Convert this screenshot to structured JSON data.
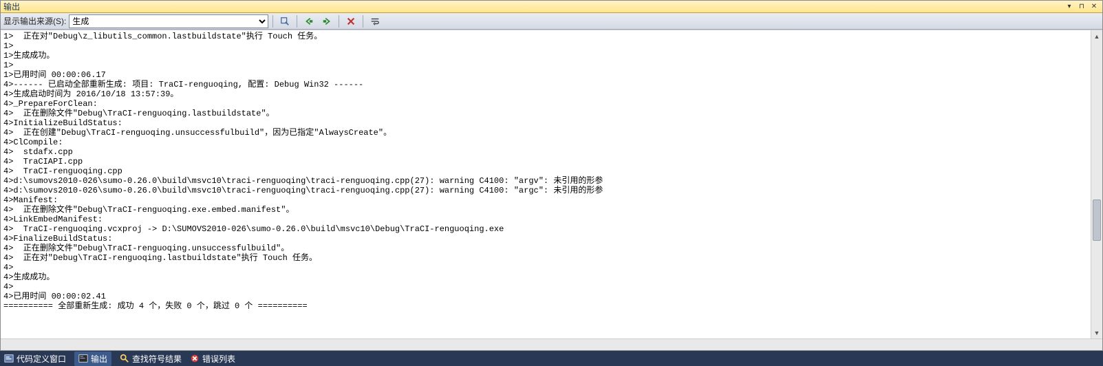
{
  "titlebar": {
    "title": "输出"
  },
  "toolbar": {
    "source_label": "显示输出来源(S):",
    "source_value": "生成"
  },
  "output_lines": [
    "1>  正在对\"Debug\\z_libutils_common.lastbuildstate\"执行 Touch 任务。",
    "1>",
    "1>生成成功。",
    "1>",
    "1>已用时间 00:00:06.17",
    "4>------ 已启动全部重新生成: 项目: TraCI-renguoqing, 配置: Debug Win32 ------",
    "4>生成启动时间为 2016/10/18 13:57:39。",
    "4>_PrepareForClean:",
    "4>  正在删除文件\"Debug\\TraCI-renguoqing.lastbuildstate\"。",
    "4>InitializeBuildStatus:",
    "4>  正在创建\"Debug\\TraCI-renguoqing.unsuccessfulbuild\"，因为已指定\"AlwaysCreate\"。",
    "4>ClCompile:",
    "4>  stdafx.cpp",
    "4>  TraCIAPI.cpp",
    "4>  TraCI-renguoqing.cpp",
    "4>d:\\sumovs2010-026\\sumo-0.26.0\\build\\msvc10\\traci-renguoqing\\traci-renguoqing.cpp(27): warning C4100: \"argv\": 未引用的形参",
    "4>d:\\sumovs2010-026\\sumo-0.26.0\\build\\msvc10\\traci-renguoqing\\traci-renguoqing.cpp(27): warning C4100: \"argc\": 未引用的形参",
    "4>Manifest:",
    "4>  正在删除文件\"Debug\\TraCI-renguoqing.exe.embed.manifest\"。",
    "4>LinkEmbedManifest:",
    "4>  TraCI-renguoqing.vcxproj -> D:\\SUMOVS2010-026\\sumo-0.26.0\\build\\msvc10\\Debug\\TraCI-renguoqing.exe",
    "4>FinalizeBuildStatus:",
    "4>  正在删除文件\"Debug\\TraCI-renguoqing.unsuccessfulbuild\"。",
    "4>  正在对\"Debug\\TraCI-renguoqing.lastbuildstate\"执行 Touch 任务。",
    "4>",
    "4>生成成功。",
    "4>",
    "4>已用时间 00:00:02.41",
    "========== 全部重新生成: 成功 4 个，失败 0 个，跳过 0 个 =========="
  ],
  "tabs": {
    "code_def": "代码定义窗口",
    "output": "输出",
    "find_symbol": "查找符号结果",
    "error_list": "错误列表"
  }
}
